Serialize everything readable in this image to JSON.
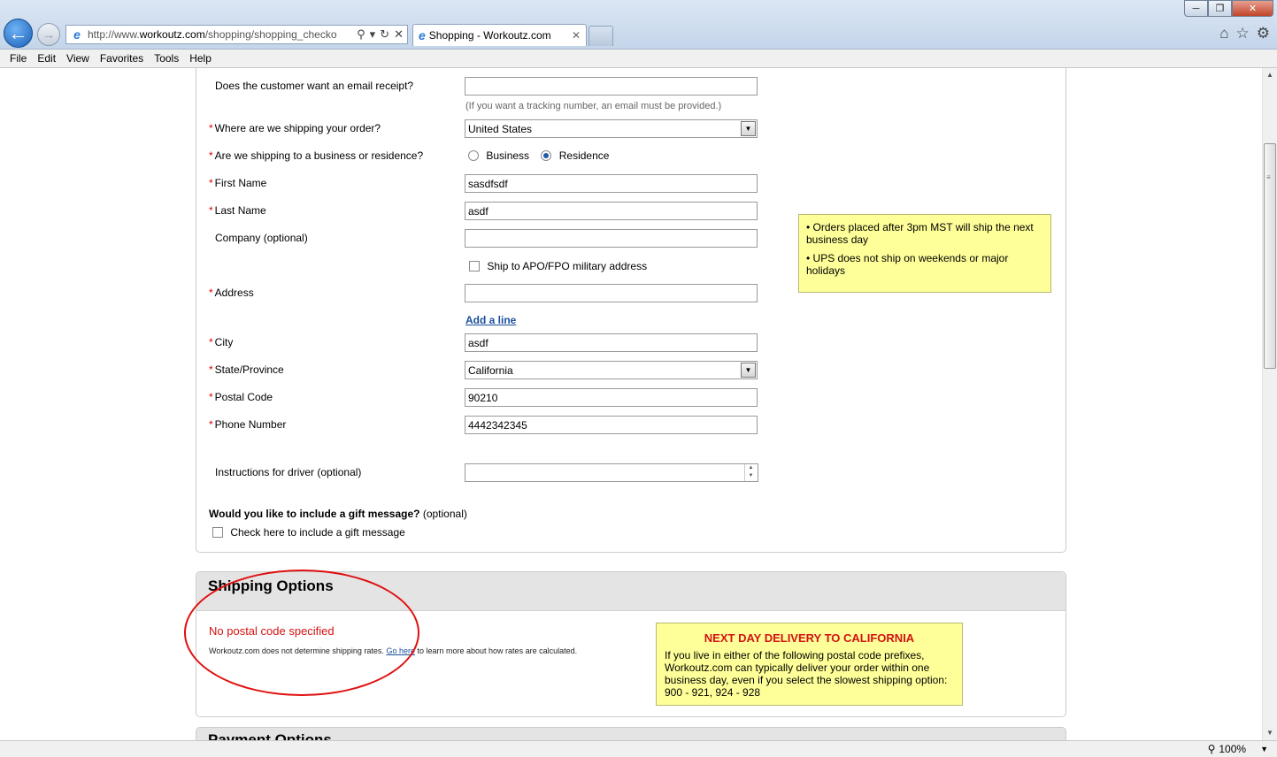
{
  "browser": {
    "url_prefix": "http://www.",
    "url_domain": "workoutz.com",
    "url_path": "/shopping/shopping_checko",
    "tab_title": "Shopping - Workoutz.com",
    "menu": [
      "File",
      "Edit",
      "View",
      "Favorites",
      "Tools",
      "Help"
    ],
    "zoom": "100%"
  },
  "form": {
    "email_receipt_label": "Does the customer want an email receipt?",
    "email_value": "",
    "email_hint": "(If you want a tracking number, an email must be provided.)",
    "ship_where_label": "Where are we shipping your order?",
    "country_value": "United States",
    "biz_res_label": "Are we shipping to a business or residence?",
    "business_label": "Business",
    "residence_label": "Residence",
    "first_name_label": "First Name",
    "first_name_value": "sasdfsdf",
    "last_name_label": "Last Name",
    "last_name_value": "asdf",
    "company_label": "Company (optional)",
    "company_value": "",
    "apo_label": "Ship to APO/FPO military address",
    "address_label": "Address",
    "address_value": "",
    "add_line": "Add a line",
    "city_label": "City",
    "city_value": "asdf",
    "state_label": "State/Province",
    "state_value": "California",
    "postal_label": "Postal Code",
    "postal_value": "90210",
    "phone_label": "Phone Number",
    "phone_value": "4442342345",
    "driver_label": "Instructions for driver (optional)",
    "driver_value": "",
    "gift_question": "Would you like to include a gift message?",
    "gift_optional": "(optional)",
    "gift_check_label": "Check here to include a gift message",
    "required_mark": "*"
  },
  "ship_note": {
    "item1": "•   Orders placed after 3pm MST will ship the next business day",
    "item2": "•   UPS does not ship on weekends or major holidays"
  },
  "shipping": {
    "title": "Shipping Options",
    "no_postal": "No postal code specified",
    "rates_prefix": "Workoutz.com does not determine shipping rates.",
    "rates_link": "Go here",
    "rates_suffix": "to learn more about how rates are calculated.",
    "nextday_title": "NEXT DAY DELIVERY TO CALIFORNIA",
    "nextday_body": "If you live in either of the following postal code prefixes, Workoutz.com can typically deliver your order within one business day, even if you select the slowest shipping option: 900 - 921, 924 - 928"
  },
  "payment": {
    "title": "Payment Options"
  }
}
